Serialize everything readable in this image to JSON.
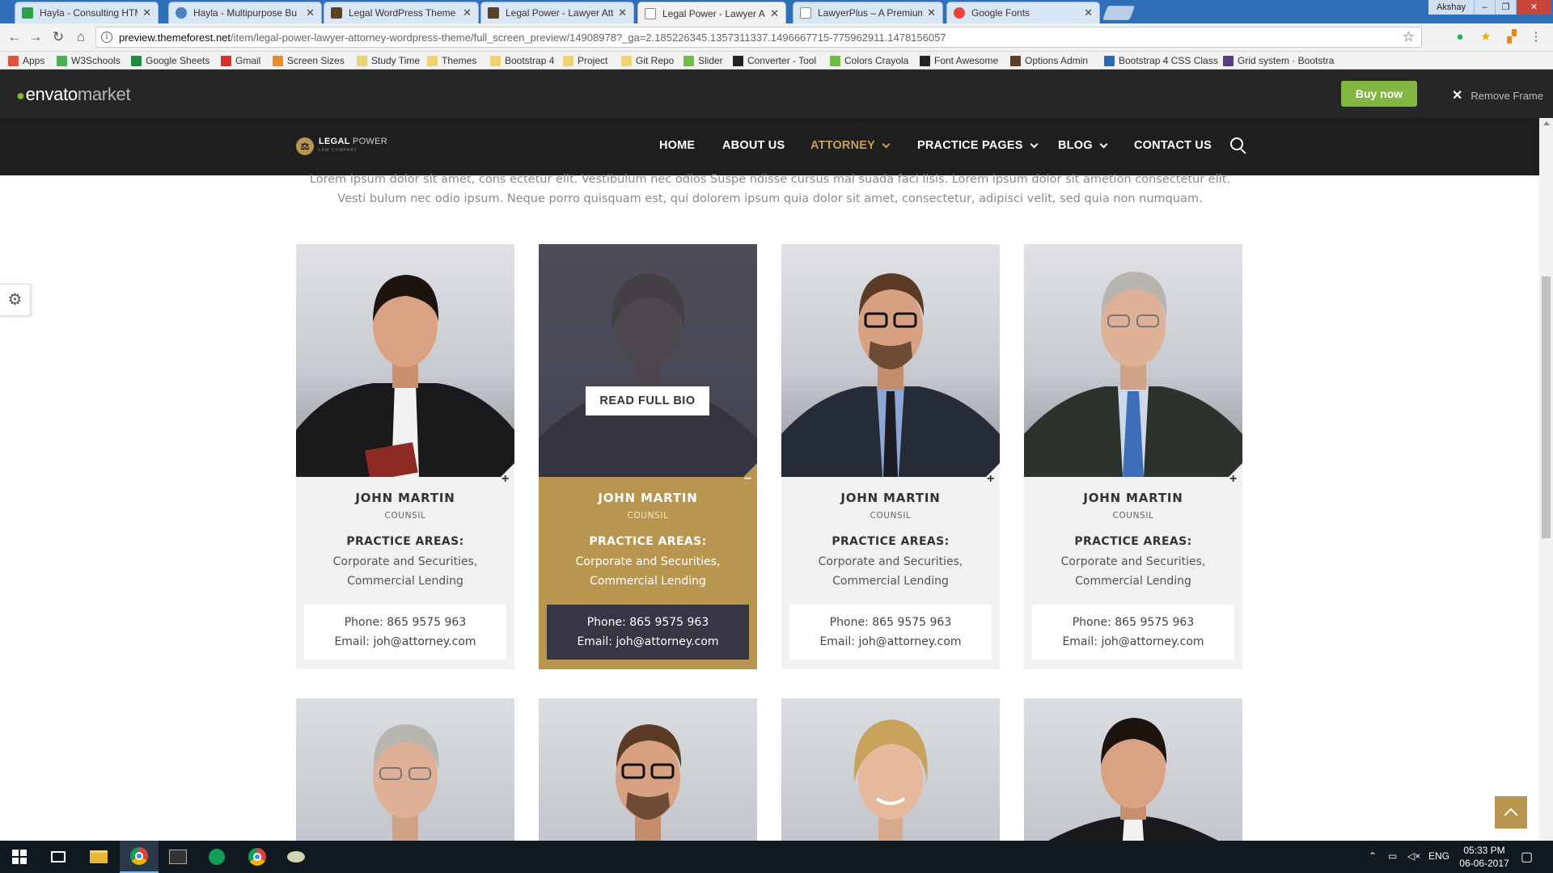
{
  "browser": {
    "tabs": [
      {
        "title": "Hayla - Consulting HTML",
        "favicon_color": "#2e9f4e"
      },
      {
        "title": "Hayla - Multipurpose Bu",
        "favicon_color": "#4a7fc1"
      },
      {
        "title": "Legal WordPress Theme",
        "favicon_color": "#5a4028"
      },
      {
        "title": "Legal Power - Lawyer Att",
        "favicon_color": "#5a4028"
      },
      {
        "title": "Legal Power - Lawyer Att",
        "favicon_color": "#888888"
      },
      {
        "title": "LawyerPlus – A Premium",
        "favicon_color": "#888888"
      },
      {
        "title": "Google Fonts",
        "favicon_color": "#e8463a"
      }
    ],
    "profile_name": "Akshay",
    "url_host": "preview.themeforest.net",
    "url_path": "/item/legal-power-lawyer-attorney-wordpress-theme/full_screen_preview/14908978?_ga=2.185226345.1357311337.1496667715-775962911.1478156057",
    "bookmarks": [
      {
        "label": "Apps",
        "color": "#e0523f"
      },
      {
        "label": "W3Schools",
        "color": "#4caf50"
      },
      {
        "label": "Google Sheets",
        "color": "#1e8e3e"
      },
      {
        "label": "Gmail",
        "color": "#d93025"
      },
      {
        "label": "Screen Sizes",
        "color": "#f08a24"
      },
      {
        "label": "Study Time",
        "color": "#f2d36b"
      },
      {
        "label": "Themes",
        "color": "#f2d36b"
      },
      {
        "label": "Bootstrap 4",
        "color": "#f2d36b"
      },
      {
        "label": "Project",
        "color": "#f2d36b"
      },
      {
        "label": "Git Repo",
        "color": "#f2d36b"
      },
      {
        "label": "Slider",
        "color": "#6cbf3a"
      },
      {
        "label": "Converter - Tool",
        "color": "#222222"
      },
      {
        "label": "Colors Crayola",
        "color": "#6cbf3a"
      },
      {
        "label": "Font Awesome",
        "color": "#222222"
      },
      {
        "label": "Options Admin",
        "color": "#5a4028"
      },
      {
        "label": "Bootstrap 4 CSS Class",
        "color": "#2a6bb5"
      },
      {
        "label": "Grid system · Bootstra",
        "color": "#563d7c"
      }
    ]
  },
  "envato": {
    "logo_main": "envato",
    "logo_sub": "market",
    "buy_label": "Buy now",
    "remove_frame_label": "Remove Frame",
    "brand_color": "#82b541"
  },
  "site": {
    "logo_text": "LEGAL",
    "logo_text_light": "POWER",
    "logo_tagline": "LAW COMPANY",
    "nav": [
      {
        "label": "HOME",
        "dropdown": false,
        "active": false
      },
      {
        "label": "ABOUT US",
        "dropdown": false,
        "active": false
      },
      {
        "label": "ATTORNEY",
        "dropdown": true,
        "active": true
      },
      {
        "label": "PRACTICE PAGES",
        "dropdown": true,
        "active": false
      },
      {
        "label": "BLOG",
        "dropdown": true,
        "active": false
      },
      {
        "label": "CONTACT US",
        "dropdown": false,
        "active": false
      }
    ],
    "accent_color": "#b9964f"
  },
  "intro_text": "Lorem ipsum dolor sit amet, cons ectetur elit. Vestibulum nec odios Suspe ndisse cursus mal suada faci lisis. Lorem ipsum dolor sit ametion consectetur elit. Vesti bulum nec odio ipsum. Neque porro quisquam est, qui dolorem ipsum quia dolor sit amet, consectetur, adipisci velit, sed quia non numquam.",
  "attorneys": [
    {
      "name": "JOHN MARTIN",
      "role": "COUNSIL",
      "practice_label": "PRACTICE AREAS:",
      "practice_line1": "Corporate and Securities,",
      "practice_line2": "Commercial Lending",
      "phone": "Phone: 865 9575 963",
      "email": "Email: joh@attorney.com",
      "toggle": "+",
      "featured": false
    },
    {
      "name": "JOHN MARTIN",
      "role": "COUNSIL",
      "practice_label": "PRACTICE AREAS:",
      "practice_line1": "Corporate and Securities,",
      "practice_line2": "Commercial Lending",
      "phone": "Phone: 865 9575 963",
      "email": "Email: joh@attorney.com",
      "toggle": "−",
      "featured": true,
      "bio_button": "READ FULL BIO"
    },
    {
      "name": "JOHN MARTIN",
      "role": "COUNSIL",
      "practice_label": "PRACTICE AREAS:",
      "practice_line1": "Corporate and Securities,",
      "practice_line2": "Commercial Lending",
      "phone": "Phone: 865 9575 963",
      "email": "Email: joh@attorney.com",
      "toggle": "+",
      "featured": false
    },
    {
      "name": "JOHN MARTIN",
      "role": "COUNSIL",
      "practice_label": "PRACTICE AREAS:",
      "practice_line1": "Corporate and Securities,",
      "practice_line2": "Commercial Lending",
      "phone": "Phone: 865 9575 963",
      "email": "Email: joh@attorney.com",
      "toggle": "+",
      "featured": false
    }
  ],
  "taskbar": {
    "language": "ENG",
    "time": "05:33 PM",
    "date": "06-06-2017"
  }
}
